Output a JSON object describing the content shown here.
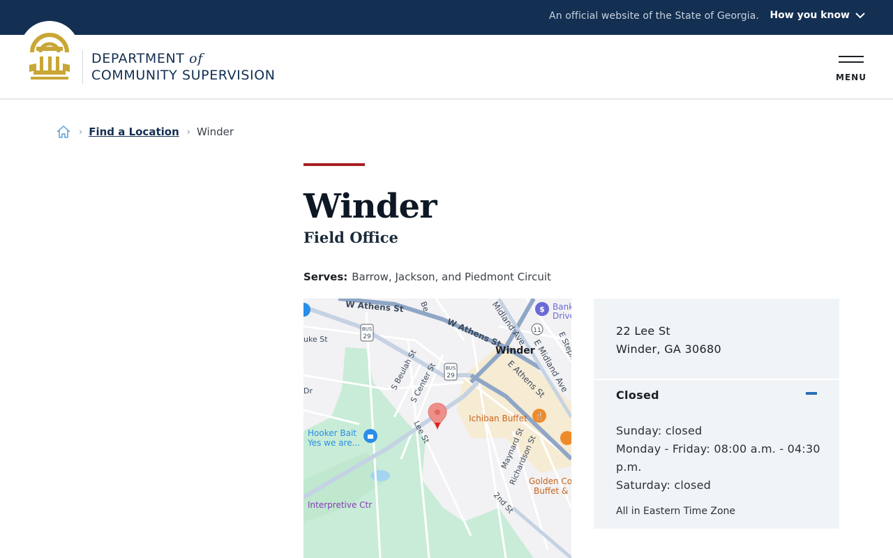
{
  "topbar": {
    "official_text": "An official website of the State of Georgia.",
    "how_you_know": "How you know"
  },
  "header": {
    "logo_line1": "DEPARTMENT",
    "logo_of": "of",
    "logo_line2": "COMMUNITY SUPERVISION",
    "menu_label": "MENU"
  },
  "breadcrumb": {
    "items": [
      {
        "label": "Find a Location"
      },
      {
        "label": "Winder"
      }
    ]
  },
  "page": {
    "title": "Winder",
    "subtitle": "Field Office",
    "serves_label": "Serves:",
    "serves_value": "Barrow, Jackson, and Piedmont Circuit"
  },
  "map": {
    "labels": {
      "w_athens_st_1": "W Athens St",
      "w_athens_st_2": "W Athens St",
      "midland_ave": "Midland Ave",
      "e_midland_ave": "E Midland Ave",
      "e_athens_st": "E Athens St",
      "winder": "Winder",
      "s_beulah_st": "S Beulah St",
      "s_center_st": "S Center St",
      "lee_st": "Lee St",
      "maynard_st": "Maynard St",
      "richardson_st": "Richardson St",
      "second_st": "2nd St",
      "ichiban": "Ichiban Buffet",
      "golden_1": "Golden Co",
      "golden_2": "Buffet &",
      "hooker_1": "Hooker Bait",
      "hooker_2": "Yes we are...",
      "interpretive": "Interpretive Ctr",
      "bank_1": "Bank",
      "bank_2": "Drive",
      "duke_st": "uke St",
      "dr": "Dr",
      "be": "Be",
      "e_steph": "E Steph",
      "bus": "BUS",
      "route_29": "29",
      "route_11": "11"
    }
  },
  "location": {
    "address_line1": "22 Lee St",
    "address_line2": "Winder, GA 30680",
    "status": "Closed",
    "hours": [
      "Sunday: closed",
      "Monday - Friday: 08:00 a.m. - 04:30 p.m.",
      "Saturday: closed"
    ],
    "timezone": "All in Eastern Time Zone"
  }
}
